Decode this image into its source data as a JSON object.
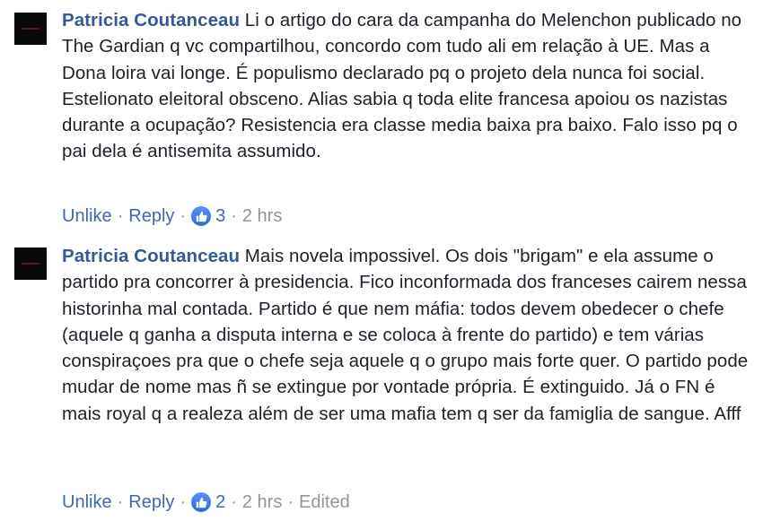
{
  "comments": [
    {
      "author": "Patricia Coutanceau",
      "text": "Li o artigo do cara da campanha do Melenchon publicado no The Gardian q vc compartilhou, concordo com tudo ali em relação à UE. Mas a Dona loira vai longe. É populismo declarado pq o projeto dela nunca foi social. Estelionato eleitoral obsceno. Alias sabia q toda elite francesa apoiou os nazistas durante a ocupação? Resistencia era classe media baixa pra baixo. Falo isso pq o pai dela é antisemita assumido.",
      "actions": {
        "unlike": "Unlike",
        "reply": "Reply",
        "like_count": "3",
        "time": "2 hrs"
      }
    },
    {
      "author": "Patricia Coutanceau",
      "text": "Mais novela impossivel. Os dois \"brigam\" e ela assume o partido pra concorrer à presidencia. Fico inconformada dos franceses cairem nessa historinha mal contada. Partido é que nem máfia: todos devem obedecer o chefe (aquele q ganha a disputa interna e se coloca à frente do partido) e tem várias conspiraçoes pra que o chefe seja aquele q o grupo mais forte quer. O partido pode mudar de nome mas ñ se extingue por vontade própria. É extinguido. Já o FN é mais royal q a realeza além de ser uma mafia tem q ser da famiglia de sangue. Afff",
      "actions": {
        "unlike": "Unlike",
        "reply": "Reply",
        "like_count": "2",
        "time": "2 hrs",
        "edited": "Edited"
      }
    }
  ],
  "separator": "·",
  "colors": {
    "link": "#4267b2",
    "author": "#365899",
    "meta": "#90949c",
    "text": "#1d2129",
    "like_badge": "#3b78e7"
  },
  "icons": {
    "avatar": "avatar-thumbnail",
    "reaction": "thumbs-up-icon"
  }
}
